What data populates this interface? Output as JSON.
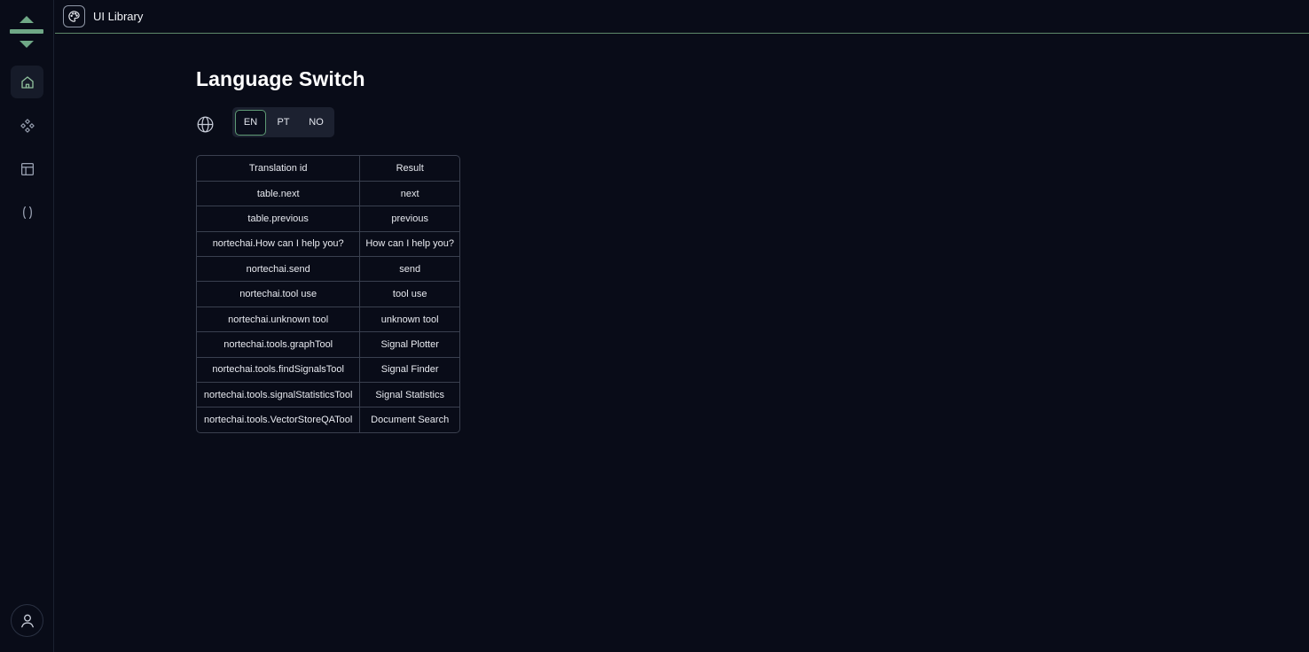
{
  "header": {
    "title": "UI Library",
    "icon": "palette-icon"
  },
  "sidebar": {
    "logo": "brand-logo",
    "items": [
      {
        "name": "home",
        "icon": "home-icon",
        "active": true
      },
      {
        "name": "components",
        "icon": "components-icon",
        "active": false
      },
      {
        "name": "layout",
        "icon": "layout-icon",
        "active": false
      },
      {
        "name": "code",
        "icon": "parentheses-icon",
        "active": false
      }
    ],
    "account_icon": "user-icon"
  },
  "main": {
    "title": "Language Switch",
    "globe_icon": "globe-icon",
    "languages": [
      {
        "label": "EN",
        "selected": true
      },
      {
        "label": "PT",
        "selected": false
      },
      {
        "label": "NO",
        "selected": false
      }
    ],
    "table": {
      "headers": [
        "Translation id",
        "Result"
      ],
      "rows": [
        [
          "table.next",
          "next"
        ],
        [
          "table.previous",
          "previous"
        ],
        [
          "nortechai.How can I help you?",
          "How can I help you?"
        ],
        [
          "nortechai.send",
          "send"
        ],
        [
          "nortechai.tool use",
          "tool use"
        ],
        [
          "nortechai.unknown tool",
          "unknown tool"
        ],
        [
          "nortechai.tools.graphTool",
          "Signal Plotter"
        ],
        [
          "nortechai.tools.findSignalsTool",
          "Signal Finder"
        ],
        [
          "nortechai.tools.signalStatisticsTool",
          "Signal Statistics"
        ],
        [
          "nortechai.tools.VectorStoreQATool",
          "Document Search"
        ]
      ]
    }
  },
  "colors": {
    "background": "#090c18",
    "accent": "#5e9a74",
    "logo": "#6fa886"
  }
}
